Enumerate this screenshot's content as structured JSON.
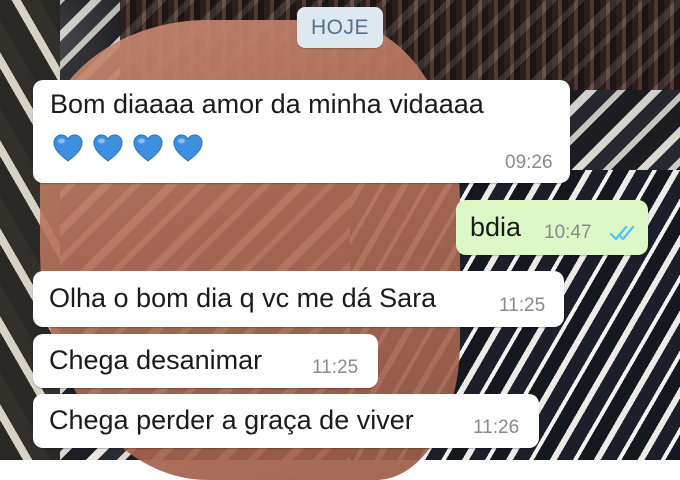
{
  "date_divider": "HOJE",
  "messages": [
    {
      "direction": "in",
      "text": "Bom diaaaa amor da minha vidaaaa",
      "emoji": "💙💙💙💙",
      "time": "09:26"
    },
    {
      "direction": "out",
      "text": "bdia",
      "time": "10:47",
      "status": "read"
    },
    {
      "direction": "in",
      "text": "Olha o bom dia q vc me dá Sara",
      "time": "11:25"
    },
    {
      "direction": "in",
      "text": "Chega desanimar",
      "time": "11:25"
    },
    {
      "direction": "in",
      "text": "Chega perder a graça de viver",
      "time": "11:26"
    }
  ],
  "colors": {
    "incoming_bubble": "#ffffff",
    "outgoing_bubble": "#dcf8c6",
    "read_ticks": "#4fc3f7",
    "date_pill": "#dde8ef",
    "heart": "#3d8fe0"
  },
  "icons": {
    "heart": "blue-heart-emoji",
    "ticks": "double-check-read-icon"
  }
}
